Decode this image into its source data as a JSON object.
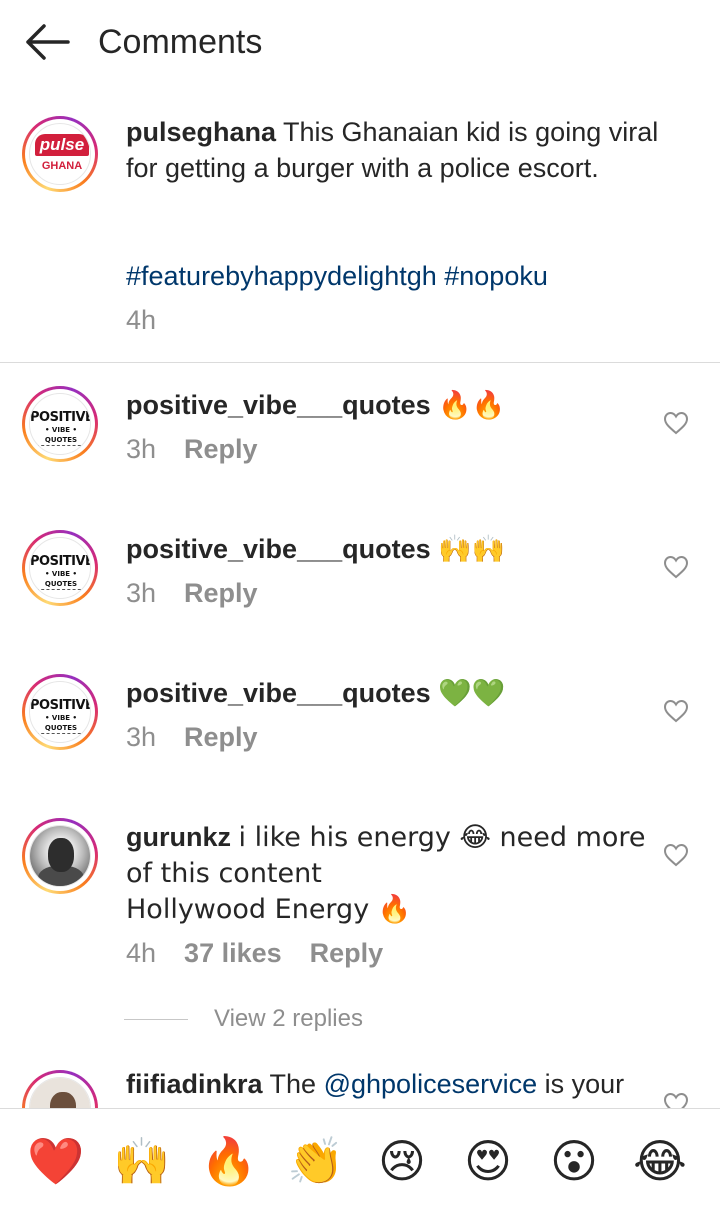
{
  "header": {
    "title": "Comments"
  },
  "post": {
    "username": "pulseghana",
    "caption": "This Ghanaian kid is going viral for getting a burger with a police escort.",
    "hashtags": "#featurebyhappydelightgh #nopoku",
    "time": "4h",
    "avatar_logo_top": "pulse",
    "avatar_logo_bottom": "GHANA"
  },
  "comments": [
    {
      "username": "positive_vibe___quotes",
      "text": "🔥🔥",
      "time": "3h",
      "reply": "Reply",
      "avatar_big": "POSITIVE",
      "avatar_small": "• VIBE • QUOTES"
    },
    {
      "username": "positive_vibe___quotes",
      "text": "🙌🙌",
      "time": "3h",
      "reply": "Reply",
      "avatar_big": "POSITIVE",
      "avatar_small": "• VIBE • QUOTES"
    },
    {
      "username": "positive_vibe___quotes",
      "text": "💚💚",
      "time": "3h",
      "reply": "Reply",
      "avatar_big": "POSITIVE",
      "avatar_small": "• VIBE • QUOTES"
    },
    {
      "username": "gurunkz",
      "text_line1": "i like his energy 😂 need more",
      "text_line2": "of this content",
      "text_line3": "Hollywood Energy 🔥",
      "time": "4h",
      "likes": "37 likes",
      "reply": "Reply",
      "view_replies": "View 2 replies"
    },
    {
      "username": "fiifiadinkra",
      "text_prefix": "The",
      "mention": "@ghpoliceservice",
      "text_suffix": "is your"
    }
  ],
  "emoji_bar": [
    "❤️",
    "🙌",
    "🔥",
    "👏",
    "😢",
    "😍",
    "😮",
    "😂"
  ],
  "colors": {
    "link": "#00376b",
    "muted": "#8e8e8e",
    "text": "#262626",
    "brand_red": "#d21f3c"
  },
  "icons": {
    "back": "arrow-left-icon",
    "like": "heart-outline-icon"
  }
}
